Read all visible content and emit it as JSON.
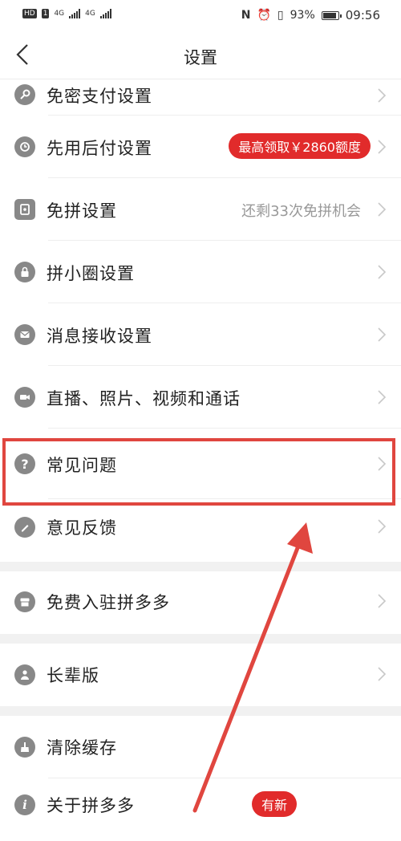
{
  "status_bar": {
    "left_badges": [
      "HD",
      "1",
      "4G",
      "4G"
    ],
    "battery": "93%",
    "battery_level": 0.93,
    "time": "09:56"
  },
  "header": {
    "title": "设置"
  },
  "rows": {
    "pay": {
      "label": "免密支付设置"
    },
    "later": {
      "label": "先用后付设置",
      "badge": "最高领取￥2860额度"
    },
    "free": {
      "label": "免拼设置",
      "hint": "还剩33次免拼机会"
    },
    "circle": {
      "label": "拼小圈设置"
    },
    "msg": {
      "label": "消息接收设置"
    },
    "live": {
      "label": "直播、照片、视频和通话"
    },
    "faq": {
      "label": "常见问题"
    },
    "feedback": {
      "label": "意见反馈"
    },
    "join": {
      "label": "免费入驻拼多多"
    },
    "elder": {
      "label": "长辈版"
    },
    "cache": {
      "label": "清除缓存"
    },
    "about": {
      "label": "关于拼多多",
      "badge": "有新"
    }
  },
  "colors": {
    "accent": "#e12b2b",
    "highlight": "#e0463f",
    "icon": "#888888"
  }
}
